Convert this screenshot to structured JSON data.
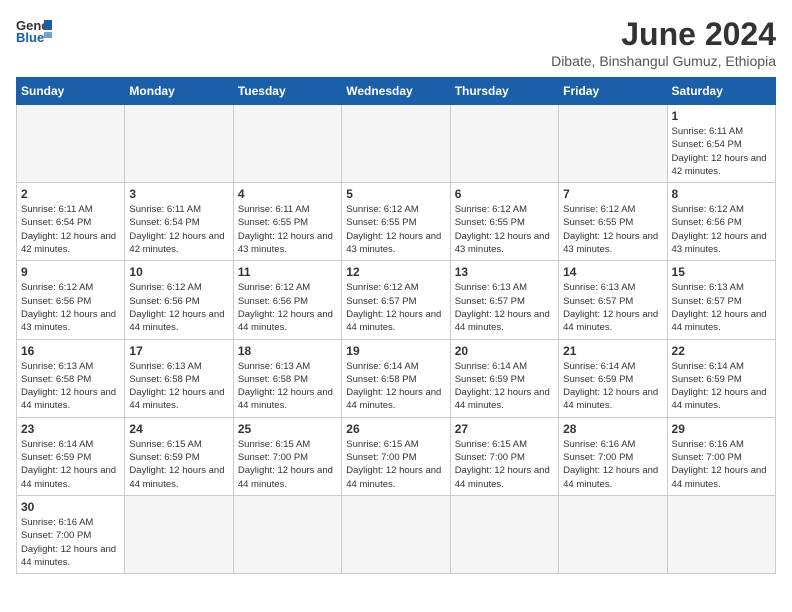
{
  "logo": {
    "text_general": "General",
    "text_blue": "Blue"
  },
  "header": {
    "month_year": "June 2024",
    "location": "Dibate, Binshangul Gumuz, Ethiopia"
  },
  "weekdays": [
    "Sunday",
    "Monday",
    "Tuesday",
    "Wednesday",
    "Thursday",
    "Friday",
    "Saturday"
  ],
  "days": [
    {
      "num": "",
      "info": ""
    },
    {
      "num": "",
      "info": ""
    },
    {
      "num": "",
      "info": ""
    },
    {
      "num": "",
      "info": ""
    },
    {
      "num": "",
      "info": ""
    },
    {
      "num": "",
      "info": ""
    },
    {
      "num": "1",
      "info": "Sunrise: 6:11 AM\nSunset: 6:54 PM\nDaylight: 12 hours and 42 minutes."
    },
    {
      "num": "2",
      "info": "Sunrise: 6:11 AM\nSunset: 6:54 PM\nDaylight: 12 hours and 42 minutes."
    },
    {
      "num": "3",
      "info": "Sunrise: 6:11 AM\nSunset: 6:54 PM\nDaylight: 12 hours and 42 minutes."
    },
    {
      "num": "4",
      "info": "Sunrise: 6:11 AM\nSunset: 6:55 PM\nDaylight: 12 hours and 43 minutes."
    },
    {
      "num": "5",
      "info": "Sunrise: 6:12 AM\nSunset: 6:55 PM\nDaylight: 12 hours and 43 minutes."
    },
    {
      "num": "6",
      "info": "Sunrise: 6:12 AM\nSunset: 6:55 PM\nDaylight: 12 hours and 43 minutes."
    },
    {
      "num": "7",
      "info": "Sunrise: 6:12 AM\nSunset: 6:55 PM\nDaylight: 12 hours and 43 minutes."
    },
    {
      "num": "8",
      "info": "Sunrise: 6:12 AM\nSunset: 6:56 PM\nDaylight: 12 hours and 43 minutes."
    },
    {
      "num": "9",
      "info": "Sunrise: 6:12 AM\nSunset: 6:56 PM\nDaylight: 12 hours and 43 minutes."
    },
    {
      "num": "10",
      "info": "Sunrise: 6:12 AM\nSunset: 6:56 PM\nDaylight: 12 hours and 44 minutes."
    },
    {
      "num": "11",
      "info": "Sunrise: 6:12 AM\nSunset: 6:56 PM\nDaylight: 12 hours and 44 minutes."
    },
    {
      "num": "12",
      "info": "Sunrise: 6:12 AM\nSunset: 6:57 PM\nDaylight: 12 hours and 44 minutes."
    },
    {
      "num": "13",
      "info": "Sunrise: 6:13 AM\nSunset: 6:57 PM\nDaylight: 12 hours and 44 minutes."
    },
    {
      "num": "14",
      "info": "Sunrise: 6:13 AM\nSunset: 6:57 PM\nDaylight: 12 hours and 44 minutes."
    },
    {
      "num": "15",
      "info": "Sunrise: 6:13 AM\nSunset: 6:57 PM\nDaylight: 12 hours and 44 minutes."
    },
    {
      "num": "16",
      "info": "Sunrise: 6:13 AM\nSunset: 6:58 PM\nDaylight: 12 hours and 44 minutes."
    },
    {
      "num": "17",
      "info": "Sunrise: 6:13 AM\nSunset: 6:58 PM\nDaylight: 12 hours and 44 minutes."
    },
    {
      "num": "18",
      "info": "Sunrise: 6:13 AM\nSunset: 6:58 PM\nDaylight: 12 hours and 44 minutes."
    },
    {
      "num": "19",
      "info": "Sunrise: 6:14 AM\nSunset: 6:58 PM\nDaylight: 12 hours and 44 minutes."
    },
    {
      "num": "20",
      "info": "Sunrise: 6:14 AM\nSunset: 6:59 PM\nDaylight: 12 hours and 44 minutes."
    },
    {
      "num": "21",
      "info": "Sunrise: 6:14 AM\nSunset: 6:59 PM\nDaylight: 12 hours and 44 minutes."
    },
    {
      "num": "22",
      "info": "Sunrise: 6:14 AM\nSunset: 6:59 PM\nDaylight: 12 hours and 44 minutes."
    },
    {
      "num": "23",
      "info": "Sunrise: 6:14 AM\nSunset: 6:59 PM\nDaylight: 12 hours and 44 minutes."
    },
    {
      "num": "24",
      "info": "Sunrise: 6:15 AM\nSunset: 6:59 PM\nDaylight: 12 hours and 44 minutes."
    },
    {
      "num": "25",
      "info": "Sunrise: 6:15 AM\nSunset: 7:00 PM\nDaylight: 12 hours and 44 minutes."
    },
    {
      "num": "26",
      "info": "Sunrise: 6:15 AM\nSunset: 7:00 PM\nDaylight: 12 hours and 44 minutes."
    },
    {
      "num": "27",
      "info": "Sunrise: 6:15 AM\nSunset: 7:00 PM\nDaylight: 12 hours and 44 minutes."
    },
    {
      "num": "28",
      "info": "Sunrise: 6:16 AM\nSunset: 7:00 PM\nDaylight: 12 hours and 44 minutes."
    },
    {
      "num": "29",
      "info": "Sunrise: 6:16 AM\nSunset: 7:00 PM\nDaylight: 12 hours and 44 minutes."
    },
    {
      "num": "30",
      "info": "Sunrise: 6:16 AM\nSunset: 7:00 PM\nDaylight: 12 hours and 44 minutes."
    },
    {
      "num": "",
      "info": ""
    },
    {
      "num": "",
      "info": ""
    },
    {
      "num": "",
      "info": ""
    },
    {
      "num": "",
      "info": ""
    },
    {
      "num": "",
      "info": ""
    },
    {
      "num": "",
      "info": ""
    }
  ]
}
